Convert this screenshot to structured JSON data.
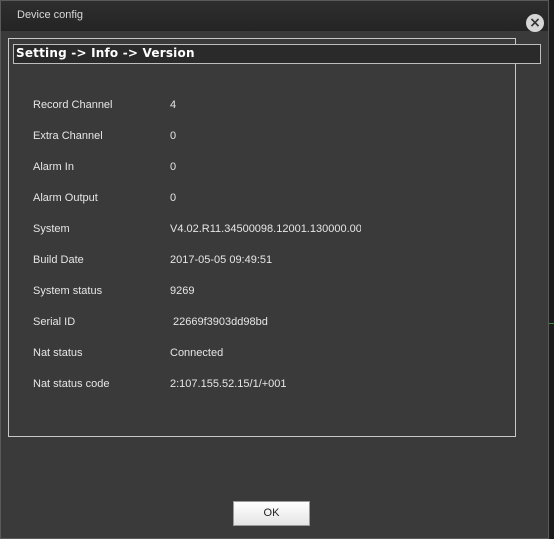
{
  "dialog": {
    "title": "Device config",
    "breadcrumb": "Setting -> Info -> Version",
    "close_glyph": "×",
    "ok_label": "OK"
  },
  "info_rows": [
    {
      "label": "Record Channel",
      "value": "4"
    },
    {
      "label": "Extra Channel",
      "value": "0"
    },
    {
      "label": "Alarm In",
      "value": "0"
    },
    {
      "label": "Alarm Output",
      "value": "0"
    },
    {
      "label": "System",
      "value": "V4.02.R11.34500098.12001.130000.0000"
    },
    {
      "label": "Build Date",
      "value": "2017-05-05 09:49:51"
    },
    {
      "label": "System status",
      "value": "9269"
    },
    {
      "label": "Serial ID",
      "value": "22669f3903dd98bd"
    },
    {
      "label": "Nat status",
      "value": "Connected"
    },
    {
      "label": "Nat status code",
      "value": "2:107.155.52.15/1/+001"
    }
  ]
}
